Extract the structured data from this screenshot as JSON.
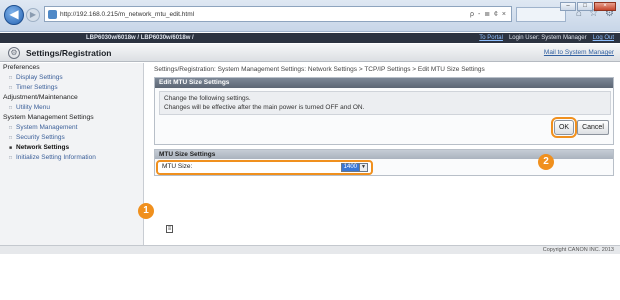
{
  "browser": {
    "url": "http://192.168.0.215/m_network_mtu_edit.html",
    "back_icon": "back-arrow-icon",
    "forward_icon": "forward-arrow-icon",
    "address_tools": "ρ - ≣ ¢ ×",
    "window_controls": [
      "–",
      "□",
      "×"
    ],
    "chrome_icons": [
      "⌂",
      "☆",
      "⚙"
    ]
  },
  "device": {
    "name": "LBP6030w/6018w / LBP6030w/6018w /",
    "portal_label": "To Portal",
    "login_text": "Login User: System Manager",
    "logout_label": "Log Out"
  },
  "header": {
    "title": "Settings/Registration",
    "mail_link": "Mail to System Manager"
  },
  "sidebar": {
    "groups": [
      {
        "label": "Preferences",
        "items": [
          {
            "label": "Display Settings",
            "active": false
          },
          {
            "label": "Timer Settings",
            "active": false
          }
        ]
      },
      {
        "label": "Adjustment/Maintenance",
        "items": [
          {
            "label": "Utility Menu",
            "active": false
          }
        ]
      },
      {
        "label": "System Management Settings",
        "items": [
          {
            "label": "System Management",
            "active": false
          },
          {
            "label": "Security Settings",
            "active": false
          },
          {
            "label": "Network Settings",
            "active": true
          },
          {
            "label": "Initialize Setting Information",
            "active": false
          }
        ]
      }
    ]
  },
  "main": {
    "breadcrumb": "Settings/Registration: System Management Settings: Network Settings > TCP/IP Settings > Edit MTU Size Settings",
    "panel_title": "Edit MTU Size Settings",
    "instructions": [
      "Change the following settings.",
      "Changes will be effective after the main power is turned OFF and ON."
    ],
    "ok_label": "OK",
    "cancel_label": "Cancel",
    "section_title": "MTU Size Settings",
    "mtu_label": "MTU Size:",
    "mtu_value": "1400",
    "page_top_icon": "page-top-icon"
  },
  "callouts": [
    "1",
    "2"
  ],
  "footer": {
    "copyright": "Copyright CANON INC. 2013"
  },
  "colors": {
    "accent": "#f0901e",
    "link": "#3b5f99",
    "panel_header": "#5c6674",
    "selected_value": "#3a77d6"
  }
}
